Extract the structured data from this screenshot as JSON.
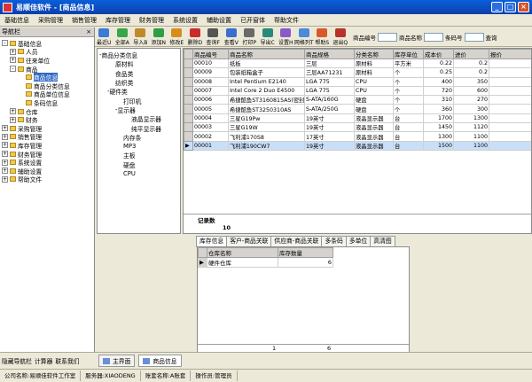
{
  "window": {
    "title": "易顺佳软件 - [商品信息]"
  },
  "menu": [
    "基础信息",
    "采购管理",
    "销售管理",
    "库存管理",
    "财务管理",
    "系统设置",
    "辅助设置",
    "已开窗体",
    "帮助文件"
  ],
  "nav": {
    "title": "导航栏",
    "close": "×",
    "items": [
      {
        "label": "基础信息",
        "toggle": "-",
        "level": 0
      },
      {
        "label": "人员",
        "toggle": "+",
        "level": 1
      },
      {
        "label": "往来单位",
        "toggle": "+",
        "level": 1
      },
      {
        "label": "商品",
        "toggle": "-",
        "level": 1
      },
      {
        "label": "商品信息",
        "toggle": "",
        "level": 2,
        "selected": true
      },
      {
        "label": "商品分类信息",
        "toggle": "",
        "level": 2
      },
      {
        "label": "商品单位信息",
        "toggle": "",
        "level": 2
      },
      {
        "label": "条码信息",
        "toggle": "",
        "level": 2
      },
      {
        "label": "仓库",
        "toggle": "+",
        "level": 1
      },
      {
        "label": "财务",
        "toggle": "+",
        "level": 1
      },
      {
        "label": "采购管理",
        "toggle": "+",
        "level": 0
      },
      {
        "label": "销售管理",
        "toggle": "+",
        "level": 0
      },
      {
        "label": "库存管理",
        "toggle": "+",
        "level": 0
      },
      {
        "label": "财务管理",
        "toggle": "+",
        "level": 0
      },
      {
        "label": "系统设置",
        "toggle": "+",
        "level": 0
      },
      {
        "label": "辅助设置",
        "toggle": "+",
        "level": 0
      },
      {
        "label": "帮助文件",
        "toggle": "+",
        "level": 0
      }
    ]
  },
  "toolbar": {
    "buttons": [
      {
        "label": "最近U",
        "color": "#3a7bd5"
      },
      {
        "label": "全部A",
        "color": "#3aa64a"
      },
      {
        "label": "导入B",
        "color": "#c08a2a"
      },
      {
        "label": "添加N",
        "color": "#2f9e44"
      },
      {
        "label": "修改E",
        "color": "#d98c1c"
      },
      {
        "label": "删除D",
        "color": "#cc2b2b"
      },
      {
        "label": "查询F",
        "color": "#555555"
      },
      {
        "label": "查看V",
        "color": "#3a6fd0"
      },
      {
        "label": "打印P",
        "color": "#6a6a6a"
      },
      {
        "label": "导出C",
        "color": "#2a8a7a"
      },
      {
        "label": "设置H",
        "color": "#8a5ac8"
      },
      {
        "label": "网格列T",
        "color": "#4a8ad8"
      },
      {
        "label": "帮助S",
        "color": "#d85a2a"
      },
      {
        "label": "退出Q",
        "color": "#b8322a"
      }
    ],
    "search_labels": [
      "商品编号",
      "商品名称",
      "条码号"
    ],
    "search_values": [
      "",
      "",
      ""
    ],
    "query_label": "查询"
  },
  "categories": [
    {
      "label": "商品分类信息",
      "level": 0,
      "toggle": "-"
    },
    {
      "label": "原材料",
      "level": 1,
      "toggle": ""
    },
    {
      "label": "食品类",
      "level": 1,
      "toggle": ""
    },
    {
      "label": "纺织类",
      "level": 1,
      "toggle": ""
    },
    {
      "label": "硬件类",
      "level": 1,
      "toggle": "-"
    },
    {
      "label": "打印机",
      "level": 2,
      "toggle": ""
    },
    {
      "label": "显示器",
      "level": 2,
      "toggle": "-"
    },
    {
      "label": "液晶显示器",
      "level": 3,
      "toggle": ""
    },
    {
      "label": "纯平显示器",
      "level": 3,
      "toggle": ""
    },
    {
      "label": "内存条",
      "level": 2,
      "toggle": ""
    },
    {
      "label": "MP3",
      "level": 2,
      "toggle": ""
    },
    {
      "label": "主板",
      "level": 2,
      "toggle": ""
    },
    {
      "label": "硬盘",
      "level": 2,
      "toggle": ""
    },
    {
      "label": "CPU",
      "level": 2,
      "toggle": ""
    }
  ],
  "products": {
    "columns": [
      "商品编号",
      "商品名称",
      "商品规格",
      "分类名称",
      "库存单位",
      "成本价",
      "进价",
      "报价"
    ],
    "rows": [
      [
        "00010",
        "纸板",
        "三层",
        "原材料",
        "平方米",
        "0.22",
        "0.2",
        ""
      ],
      [
        "00009",
        "包装纸箱盒子",
        "三层AA71231",
        "原材料",
        "个",
        "0.25",
        "0.2",
        ""
      ],
      [
        "00008",
        "Intel Pentium E2140",
        "LGA 775",
        "CPU",
        "个",
        "400",
        "350",
        ""
      ],
      [
        "00007",
        "Intel Core 2 Duo E4500",
        "LGA 775",
        "CPU",
        "个",
        "720",
        "600",
        ""
      ],
      [
        "00006",
        "希捷酷鱼ST3160815AS(密封)",
        "S-ATA/160G",
        "硬盘",
        "个",
        "310",
        "270",
        ""
      ],
      [
        "00005",
        "希捷酷鱼ST3250310AS",
        "S-ATA/250G",
        "硬盘",
        "个",
        "360",
        "300",
        ""
      ],
      [
        "00004",
        "三星G19Pw",
        "19英寸",
        "液晶显示器",
        "台",
        "1700",
        "1300",
        "2"
      ],
      [
        "00003",
        "三星G19W",
        "19英寸",
        "液晶显示器",
        "台",
        "1450",
        "1120",
        "1"
      ],
      [
        "00002",
        "飞利浦170S8",
        "17英寸",
        "液晶显示器",
        "台",
        "1300",
        "1100",
        "1"
      ],
      [
        "00001",
        "飞利浦190CW7",
        "19英寸",
        "液晶显示器",
        "台",
        "1500",
        "1100",
        "2"
      ]
    ],
    "selected_index": 9,
    "record_label": "记录数",
    "record_count": "10"
  },
  "detail_tabs": [
    "库存信息",
    "客户-商品关联",
    "供应商-商品关联",
    "多条码",
    "多单位",
    "高清图"
  ],
  "stock": {
    "columns": [
      "仓库名称",
      "库存数量"
    ],
    "rows": [
      [
        "硬件仓库",
        "6"
      ]
    ],
    "footer_count": "1",
    "footer_total": "6"
  },
  "bottom": {
    "links": [
      "隐藏导航栏",
      "计算器",
      "联系我们"
    ],
    "tabs": [
      "主界面",
      "商品信息"
    ]
  },
  "status": [
    "公司名称:易顺佳软件工作室",
    "服务器:XIAODENG",
    "账套名称:A账套",
    "操作员:管理员"
  ]
}
